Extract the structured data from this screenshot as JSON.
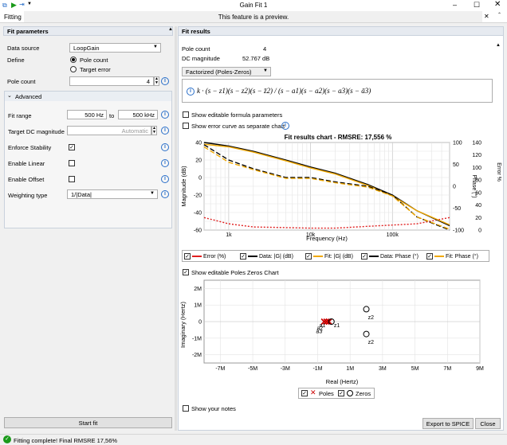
{
  "window": {
    "title": "Gain Fit 1"
  },
  "ribbon": {
    "tab": "Fitting",
    "notice": "This feature is a preview."
  },
  "left": {
    "header": "Fit parameters",
    "data_source_label": "Data source",
    "data_source": "LoopGain",
    "define_label": "Define",
    "opt_pole": "Pole count",
    "opt_target": "Target error",
    "pole_count_label": "Pole count",
    "pole_count": "4",
    "advanced": "Advanced",
    "fit_range_label": "Fit range",
    "fit_from": "500 Hz",
    "fit_to_label": "to",
    "fit_to": "500 kHz",
    "target_dc_label": "Target DC magnitude",
    "target_dc_placeholder": "Automatic",
    "enforce_label": "Enforce Stability",
    "linear_label": "Enable Linear",
    "offset_label": "Enable Offset",
    "weighting_label": "Weighting type",
    "weighting": "1/|Data|",
    "start_button": "Start fit"
  },
  "right": {
    "header": "Fit results",
    "pole_count_label": "Pole count",
    "pole_count": "4",
    "dc_label": "DC magnitude",
    "dc": "52.767 dB",
    "form_select": "Factorized (Poles-Zeros)",
    "formula": "k · (s − z1)(s − z2)(s − z̄2) / (s − a1)(s − a2)(s − a3)(s − ā3)",
    "show_formula": "Show editable formula parameters",
    "show_error": "Show error curve as separate chart",
    "show_pz": "Show editable Poles Zeros Chart",
    "show_notes": "Show your notes",
    "export": "Export to SPICE",
    "close": "Close"
  },
  "status": {
    "text": "Fitting complete! Final RMSRE 17,56%"
  },
  "chart_data": [
    {
      "type": "line",
      "title": "Fit results chart - RMSRE: 17,556 %",
      "xlabel": "Frequency (Hz)",
      "x_ticks": [
        "1k",
        "10k",
        "100k"
      ],
      "x": [
        500,
        1000,
        2000,
        5000,
        10000,
        20000,
        50000,
        100000,
        200000,
        500000
      ],
      "ylim_left": [
        -60,
        40
      ],
      "ylabel_left": "Magnitude (dB)",
      "y_ticks_left": [
        "40",
        "20",
        "0",
        "-20",
        "-40",
        "-60"
      ],
      "ylim_phase": [
        -100,
        100
      ],
      "ylabel_phase": "Phase (°)",
      "y_ticks_phase": [
        "100",
        "50",
        "0",
        "-50",
        "-100"
      ],
      "ylim_error": [
        0,
        140
      ],
      "ylabel_error": "Error %",
      "y_ticks_error": [
        "140",
        "120",
        "100",
        "80",
        "60",
        "40",
        "20",
        "0"
      ],
      "series": [
        {
          "name": "Error (%)",
          "axis": "error",
          "color": "#e02020",
          "dash": "2,2",
          "values": [
            20,
            10,
            5,
            4,
            3,
            3,
            6,
            8,
            10,
            20
          ]
        },
        {
          "name": "Data: |G| (dB)",
          "axis": "left",
          "color": "#000000",
          "dash": "",
          "values": [
            40,
            36,
            30,
            20,
            12,
            5,
            -8,
            -20,
            -38,
            -55
          ]
        },
        {
          "name": "Fit: |G| (dB)",
          "axis": "left",
          "color": "#f0a800",
          "dash": "",
          "values": [
            38,
            35,
            29,
            19,
            11,
            4,
            -9,
            -21,
            -38,
            -54
          ]
        },
        {
          "name": "Data: Phase (°)",
          "axis": "phase",
          "color": "#000000",
          "dash": "6,3",
          "values": [
            95,
            60,
            40,
            20,
            20,
            10,
            0,
            -20,
            -70,
            -100
          ]
        },
        {
          "name": "Fit: Phase (°)",
          "axis": "phase",
          "color": "#f0a800",
          "dash": "6,3",
          "values": [
            90,
            55,
            38,
            18,
            18,
            8,
            -2,
            -22,
            -70,
            -98
          ]
        }
      ],
      "grid": true
    },
    {
      "type": "scatter",
      "xlabel": "Real (Hertz)",
      "ylabel": "Imaginary (Hertz)",
      "x_ticks": [
        "-7M",
        "-5M",
        "-3M",
        "-1M",
        "1M",
        "3M",
        "5M",
        "7M",
        "9M"
      ],
      "y_ticks": [
        "2M",
        "1M",
        "0",
        "-1M",
        "-2M"
      ],
      "xlim": [
        -8,
        9
      ],
      "ylim": [
        -2.5,
        2.5
      ],
      "poles": [
        {
          "x": -0.3,
          "y": 0
        },
        {
          "x": -0.6,
          "y": 0
        },
        {
          "x": -0.45,
          "y": 0
        }
      ],
      "zeros": [
        {
          "x": -0.15,
          "y": 0
        },
        {
          "x": 2,
          "y": 0.75
        },
        {
          "x": 2,
          "y": -0.75
        }
      ],
      "labels": [
        "a1",
        "a2",
        "a3",
        "z1",
        "z2",
        "z2"
      ],
      "legend": [
        "Poles",
        "Zeros"
      ]
    }
  ]
}
